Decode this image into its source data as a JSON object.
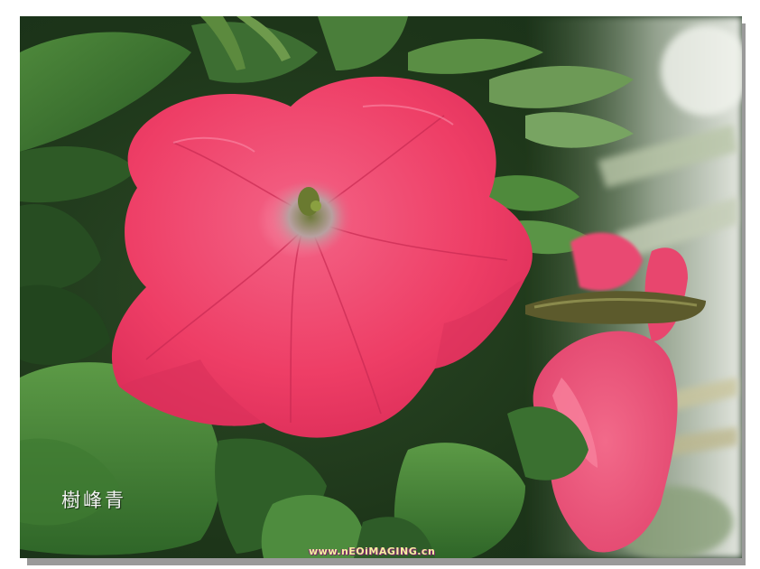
{
  "photo": {
    "subject": "pink-petunia-flower",
    "signature_text": "樹峰青",
    "watermark_text": "www.nEOiMAGING.cn",
    "colors": {
      "petal": "#f0406a",
      "petal_dark": "#c8284e",
      "leaf": "#3f7a34",
      "leaf_dark": "#1f3a1c",
      "background_light": "#e8ece6",
      "shadow": "#9a9a9a"
    }
  }
}
